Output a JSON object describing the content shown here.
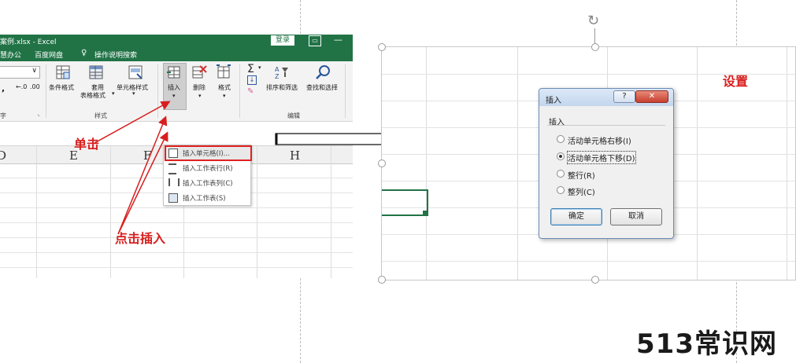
{
  "excel": {
    "title": "案例.xlsx  -  Excel",
    "login": "登录",
    "tabs": [
      "慧办公",
      "百度网盘",
      "操作说明搜索"
    ],
    "ribbon": {
      "conditional_format": "条件格式",
      "table_format_1": "套用",
      "table_format_2": "表格格式",
      "cell_styles": "单元格样式",
      "insert": "插入",
      "delete": "删除",
      "format": "格式",
      "sort_filter": "排序和筛选",
      "find_select": "查找和选择",
      "group_styles": "样式",
      "group_edit": "编辑",
      "group_char": "字",
      "percent_a": "←.0",
      "percent_b": ".00"
    },
    "insert_menu": [
      "插入单元格(I)...",
      "插入工作表行(R)",
      "插入工作表列(C)",
      "插入工作表(S)"
    ],
    "column_headers": [
      "D",
      "E",
      "F",
      "H"
    ]
  },
  "annotations": {
    "click": "单击",
    "click_insert": "点击插入",
    "settings": "设置"
  },
  "dialog": {
    "title": "插入",
    "help": "?",
    "close": "✕",
    "group": "插入",
    "options": [
      {
        "label": "活动单元格右移(I)",
        "selected": false
      },
      {
        "label": "活动单元格下移(D)",
        "selected": true
      },
      {
        "label": "整行(R)",
        "selected": false
      },
      {
        "label": "整列(C)",
        "selected": false
      }
    ],
    "ok": "确定",
    "cancel": "取消"
  },
  "watermark": "513常识网",
  "colors": {
    "excel_green": "#217346",
    "annotation_red": "#d81e1e",
    "selection_green": "#217346"
  }
}
